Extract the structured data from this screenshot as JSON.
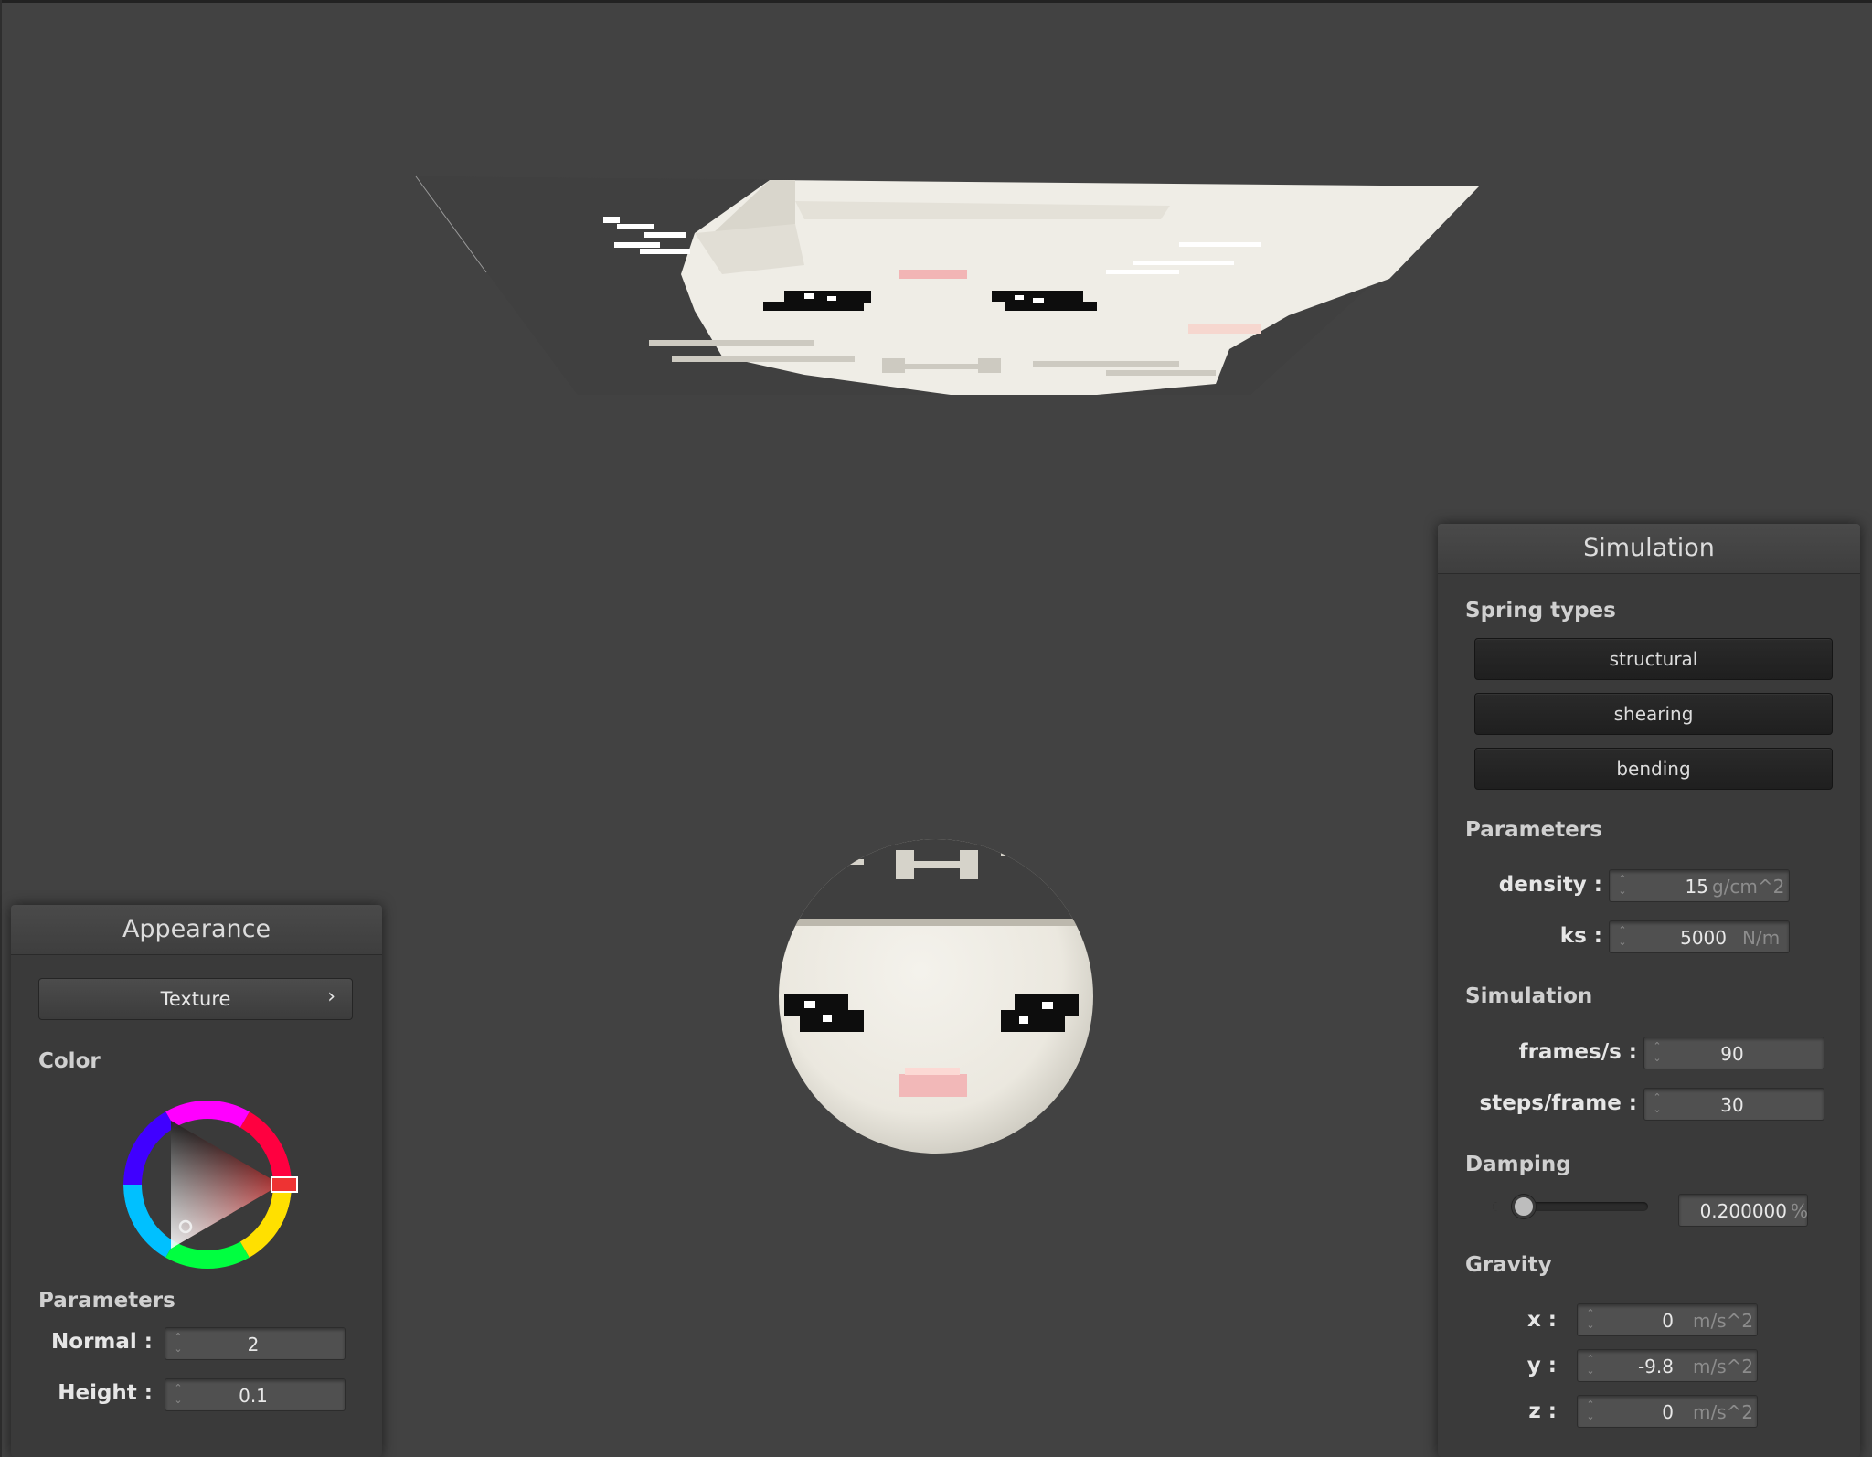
{
  "appearance": {
    "title": "Appearance",
    "texture_button": "Texture",
    "chevron": "›",
    "color_label": "Color",
    "color_accent": "#ff0000",
    "parameters_label": "Parameters",
    "normal_label": "Normal :",
    "normal_value": "2",
    "height_label": "Height :",
    "height_value": "0.1"
  },
  "simulation_panel": {
    "title": "Simulation",
    "spring_types_label": "Spring types",
    "spring_buttons": [
      "structural",
      "shearing",
      "bending"
    ],
    "parameters_label": "Parameters",
    "density_label": "density :",
    "density_value": "15",
    "density_unit": "g/cm^2",
    "ks_label": "ks :",
    "ks_value": "5000",
    "ks_unit": "N/m",
    "simulation_label": "Simulation",
    "fps_label": "frames/s :",
    "fps_value": "90",
    "steps_label": "steps/frame :",
    "steps_value": "30",
    "damping_label": "Damping",
    "damping_value": "0.200000",
    "damping_unit": "%",
    "damping_fraction": 0.2,
    "gravity_label": "Gravity",
    "gravity_x_label": "x :",
    "gravity_x_value": "0",
    "gravity_y_label": "y :",
    "gravity_y_value": "-9.8",
    "gravity_z_label": "z :",
    "gravity_z_value": "0",
    "gravity_unit": "m/s^2"
  },
  "scene": {
    "background": "#424242",
    "cloth_color": "#efede6",
    "sphere_color": "#efede6"
  }
}
